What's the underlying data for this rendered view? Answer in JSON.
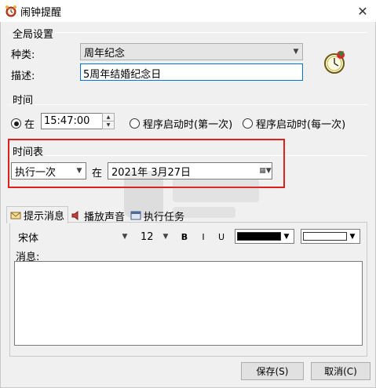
{
  "window": {
    "title": "闹钟提醒"
  },
  "global": {
    "group_label": "全局设置",
    "category_label": "种类:",
    "category_value": "周年纪念",
    "description_label": "描述:",
    "description_value": "5周年结婚纪念日"
  },
  "time": {
    "group_label": "时间",
    "at_label": "在",
    "time_value": "15:47:00",
    "startup_first_label": "程序启动时(第一次)",
    "startup_each_label": "程序启动时(每一次)",
    "selected": "at"
  },
  "schedule": {
    "group_label": "时间表",
    "frequency_value": "执行一次",
    "at_label": "在",
    "date_value": "2021年 3月27日"
  },
  "tabs": [
    {
      "label": "提示消息",
      "active": true
    },
    {
      "label": "播放声音",
      "active": false
    },
    {
      "label": "执行任务",
      "active": false
    }
  ],
  "message": {
    "font_value": "宋体",
    "size_value": "12",
    "bold_label": "B",
    "italic_label": "I",
    "underline_label": "U",
    "text_color": "#000000",
    "background_color": "#ffffff",
    "message_label": "消息:",
    "message_value": ""
  },
  "buttons": {
    "save_label": "保存(S)",
    "cancel_label": "取消(C)"
  },
  "colors": {
    "highlight_border": "#e0201c",
    "focus_border": "#0078d7"
  }
}
